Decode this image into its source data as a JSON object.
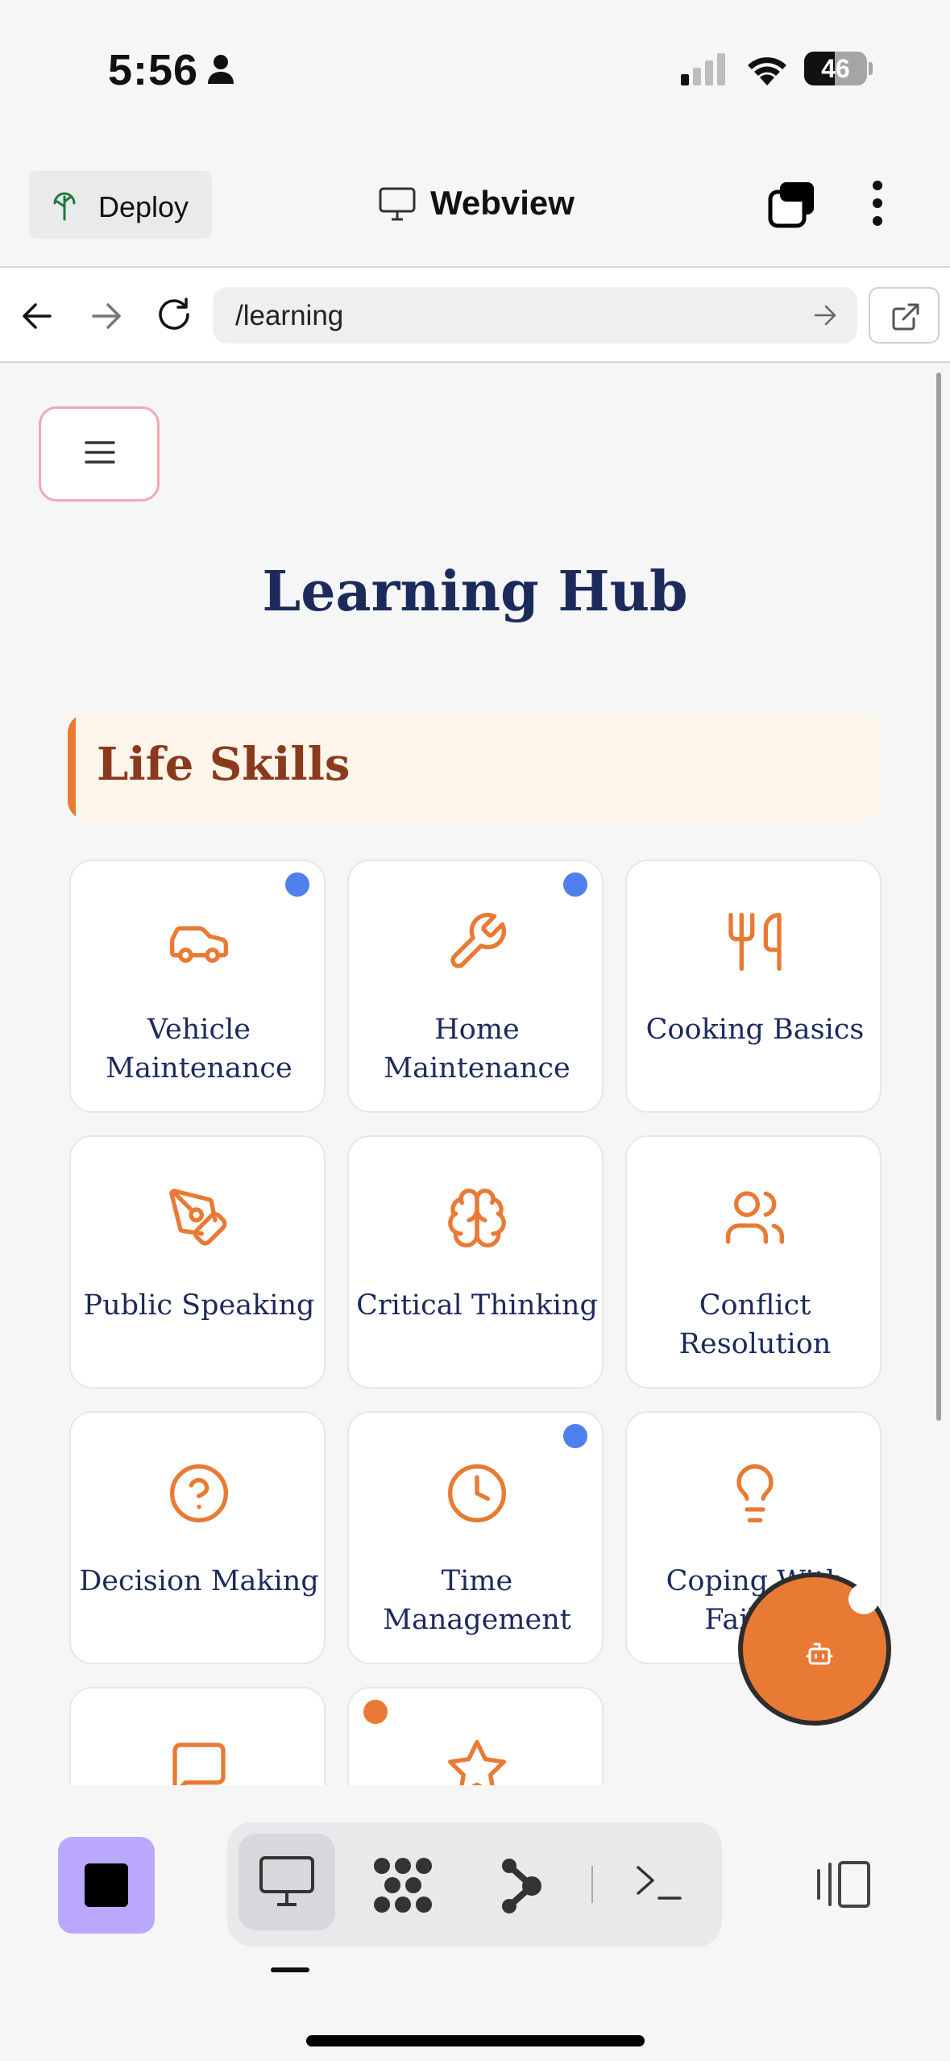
{
  "status_bar": {
    "time": "5:56",
    "battery": "46"
  },
  "header": {
    "deploy_label": "Deploy",
    "title": "Webview"
  },
  "urlbar": {
    "url": "/learning"
  },
  "page": {
    "title": "Learning Hub",
    "section_title": "Life Skills",
    "cards": [
      {
        "label": "Vehicle Maintenance",
        "icon": "car-icon",
        "badge": "blue"
      },
      {
        "label": "Home Maintenance",
        "icon": "wrench-icon",
        "badge": "blue"
      },
      {
        "label": "Cooking Basics",
        "icon": "utensils-icon",
        "badge": ""
      },
      {
        "label": "Public Speaking",
        "icon": "pen-tool-icon",
        "badge": ""
      },
      {
        "label": "Critical Thinking",
        "icon": "brain-icon",
        "badge": ""
      },
      {
        "label": "Conflict Resolution",
        "icon": "users-icon",
        "badge": ""
      },
      {
        "label": "Decision Making",
        "icon": "help-circle-icon",
        "badge": ""
      },
      {
        "label": "Time Management",
        "icon": "clock-icon",
        "badge": "blue"
      },
      {
        "label": "Coping With Failure",
        "icon": "lightbulb-icon",
        "badge": ""
      },
      {
        "label": "",
        "icon": "message-square-icon",
        "badge": ""
      },
      {
        "label": "",
        "icon": "star-icon",
        "badge": "orange"
      }
    ]
  },
  "colors": {
    "accent": "#e87a34",
    "title": "#1c2a5c",
    "section_text": "#8a3a1c",
    "badge_blue": "#4e80ee",
    "badge_orange": "#e87a34",
    "stop_button": "#b9a8fb"
  },
  "bottom_toolbar": {
    "items": [
      "desktop-icon",
      "dots-grid-icon",
      "graph-icon",
      "terminal-icon",
      "panel-icon"
    ],
    "active": "desktop-icon"
  }
}
